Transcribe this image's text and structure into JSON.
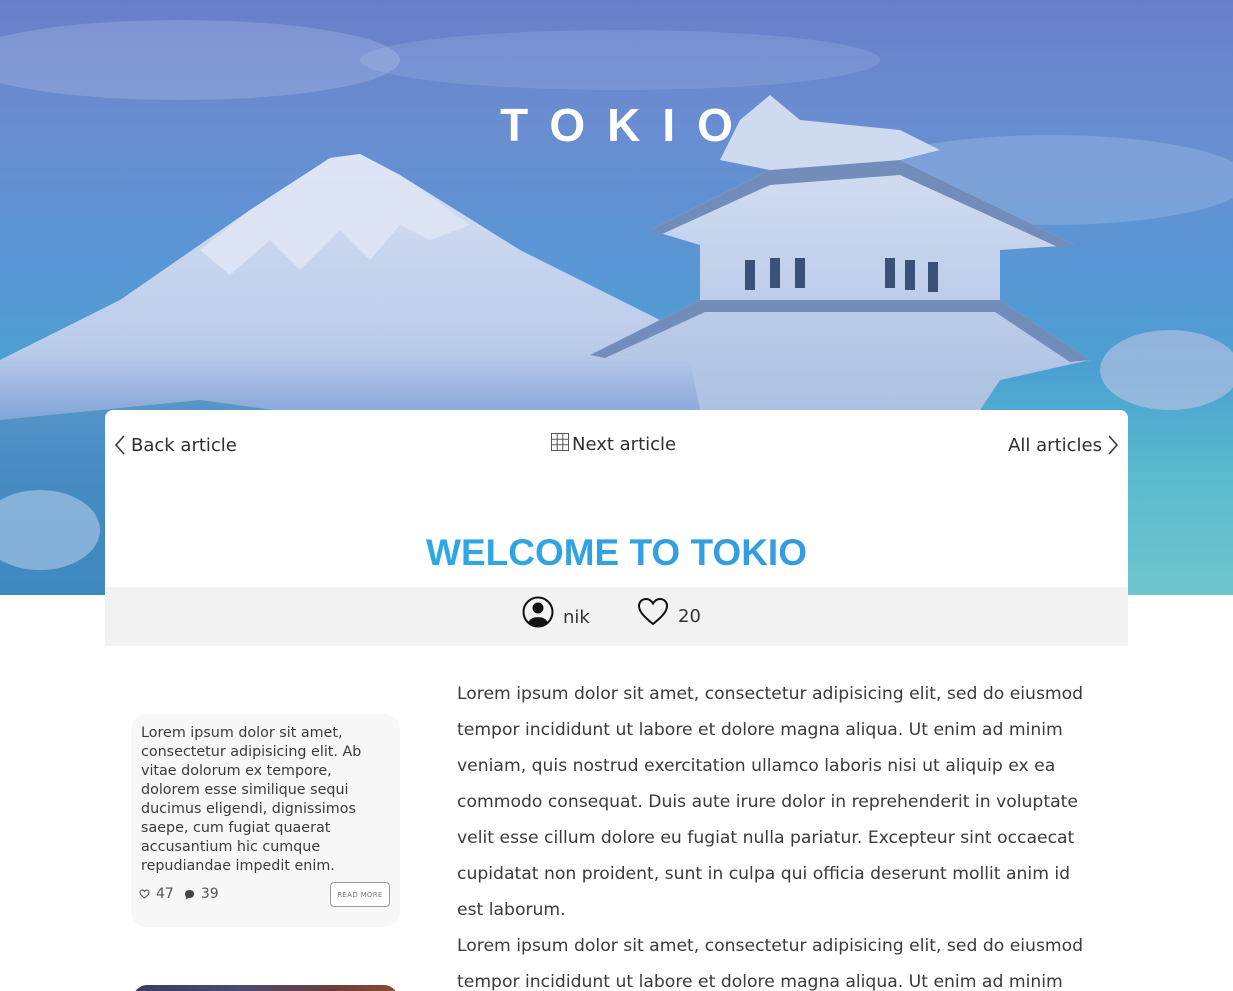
{
  "hero": {
    "title": "TOKIO"
  },
  "nav": {
    "back_label": "Back article",
    "next_label": "Next article",
    "all_label": "All articles"
  },
  "article": {
    "title": "WELCOME TO TOKIO",
    "author": "nik",
    "likes": "20",
    "paragraphs": [
      "Lorem ipsum dolor sit amet, consectetur adipisicing elit, sed do eiusmod tempor incididunt ut labore et dolore magna aliqua. Ut enim ad minim veniam, quis nostrud exercitation ullamco laboris nisi ut aliquip ex ea commodo consequat. Duis aute irure dolor in reprehenderit in voluptate velit esse cillum dolore eu fugiat nulla pariatur. Excepteur sint occaecat cupidatat non proident, sunt in culpa qui officia deserunt mollit anim id est laborum.",
      "Lorem ipsum dolor sit amet, consectetur adipisicing elit, sed do eiusmod tempor incididunt ut labore et dolore magna aliqua. Ut enim ad minim"
    ]
  },
  "sidebar": {
    "card": {
      "text": "Lorem ipsum dolor sit amet, consectetur adipisicing elit. Ab vitae dolorum ex tempore, dolorem esse similique sequi ducimus eligendi, dignissimos saepe, cum fugiat quaerat accusantium hic cumque repudiandae impedit enim.",
      "likes": "47",
      "comments": "39",
      "read_more_label": "READ MORE"
    }
  },
  "colors": {
    "title_gradient_start": "#25b4e6",
    "title_gradient_end": "#3d8fdc",
    "meta_bar": "#f2f2f2"
  },
  "icons": {
    "back": "chevron-left-icon",
    "next": "grid-icon",
    "all": "chevron-right-icon",
    "author": "user-circle-icon",
    "likes": "heart-icon",
    "comments": "comment-icon"
  }
}
